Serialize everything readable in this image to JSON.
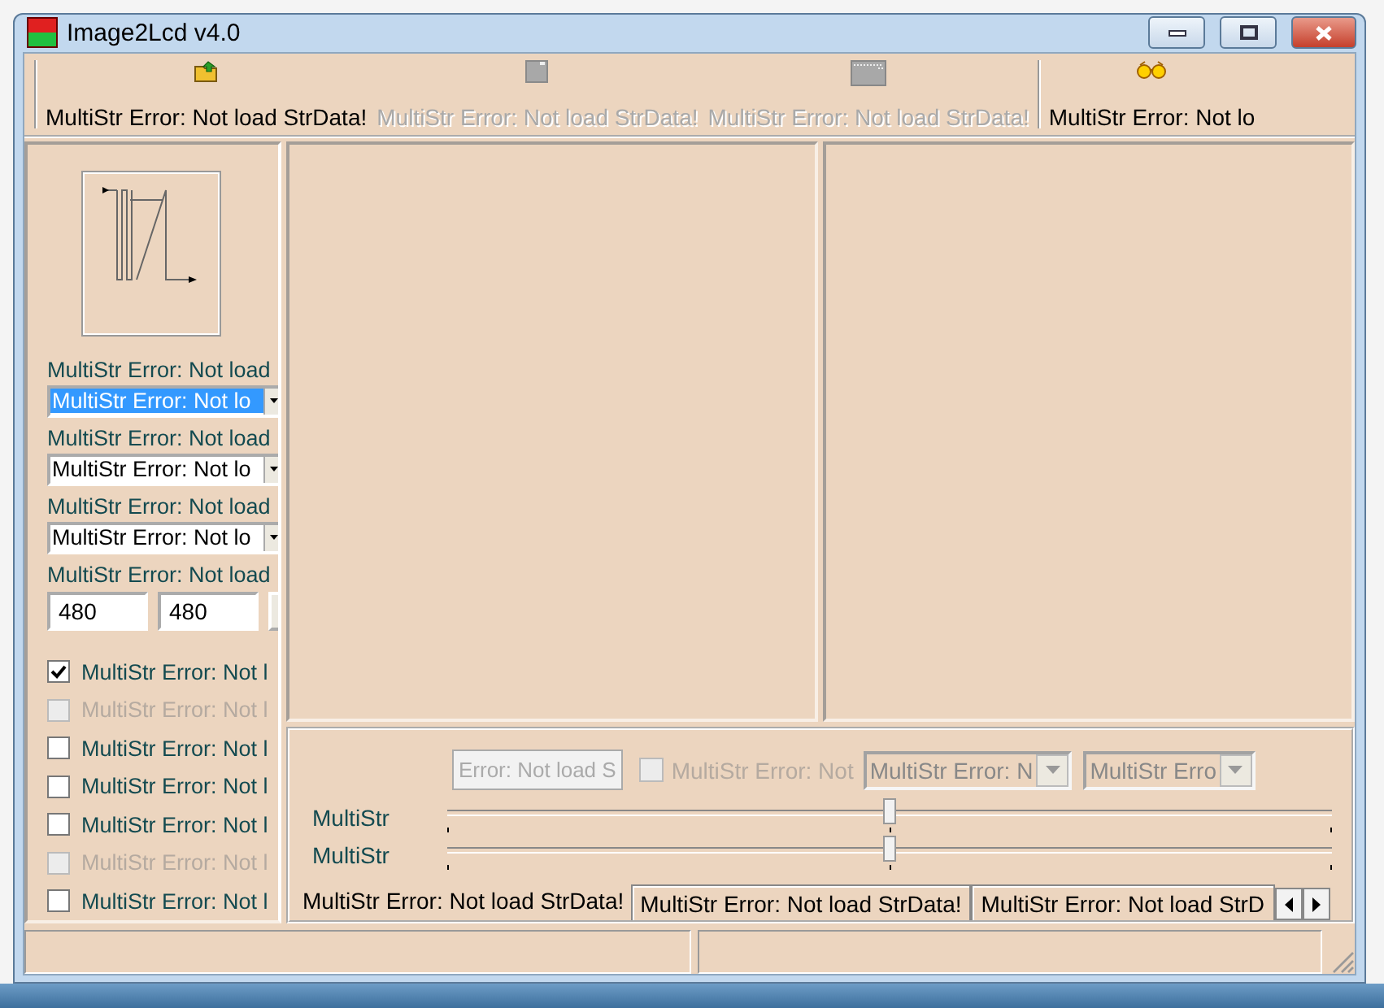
{
  "window": {
    "title": "Image2Lcd v4.0"
  },
  "toolbar": [
    {
      "kind": "open",
      "label": "MultiStr Error: Not load StrData!",
      "disabled": false
    },
    {
      "kind": "save",
      "label": "MultiStr Error: Not load StrData!",
      "disabled": true
    },
    {
      "kind": "batch",
      "label": "MultiStr Error: Not load StrData!",
      "disabled": true
    },
    {
      "kind": "view",
      "label": "MultiStr Error: Not lo",
      "disabled": false
    }
  ],
  "options": [
    {
      "kind": "combo",
      "label": "MultiStr Error: Not load",
      "value": "MultiStr Error: Not lo",
      "focused": true
    },
    {
      "kind": "combo",
      "label": "MultiStr Error: Not load",
      "value": "MultiStr Error: Not lo",
      "focused": false
    },
    {
      "kind": "combo",
      "label": "MultiStr Error: Not load",
      "value": "MultiStr Error: Not lo",
      "focused": false
    },
    {
      "kind": "size",
      "label": "MultiStr Error: Not load",
      "values": [
        "480",
        "480"
      ]
    }
  ],
  "checkboxes": [
    {
      "label": "MultiStr Error: Not l",
      "checked": true,
      "disabled": false
    },
    {
      "label": "MultiStr Error: Not l",
      "checked": false,
      "disabled": true
    },
    {
      "label": "MultiStr Error: Not l",
      "checked": false,
      "disabled": false
    },
    {
      "label": "MultiStr Error: Not l",
      "checked": false,
      "disabled": false
    },
    {
      "label": "MultiStr Error: Not l",
      "checked": false,
      "disabled": false
    },
    {
      "label": "MultiStr Error: Not l",
      "checked": false,
      "disabled": true
    },
    {
      "label": "MultiStr Error: Not l",
      "checked": false,
      "disabled": false
    }
  ],
  "adjust": {
    "button": {
      "label": "Error: Not load S",
      "disabled": true
    },
    "checkbox": {
      "label": "MultiStr Error: Not",
      "checked": false,
      "disabled": true
    },
    "dropdowns": [
      {
        "value": "MultiStr Error: N",
        "disabled": true
      },
      {
        "value": "MultiStr Erro",
        "disabled": true
      }
    ],
    "sliders": [
      {
        "label": "MultiStr",
        "level": 0.5
      },
      {
        "label": "MultiStr",
        "level": 0.5
      }
    ]
  },
  "tabs": [
    {
      "label": "MultiStr Error: Not load StrData!",
      "selected": true
    },
    {
      "label": "MultiStr Error: Not load StrData!",
      "selected": false
    },
    {
      "label": "MultiStr Error: Not load StrD",
      "selected": false
    }
  ]
}
